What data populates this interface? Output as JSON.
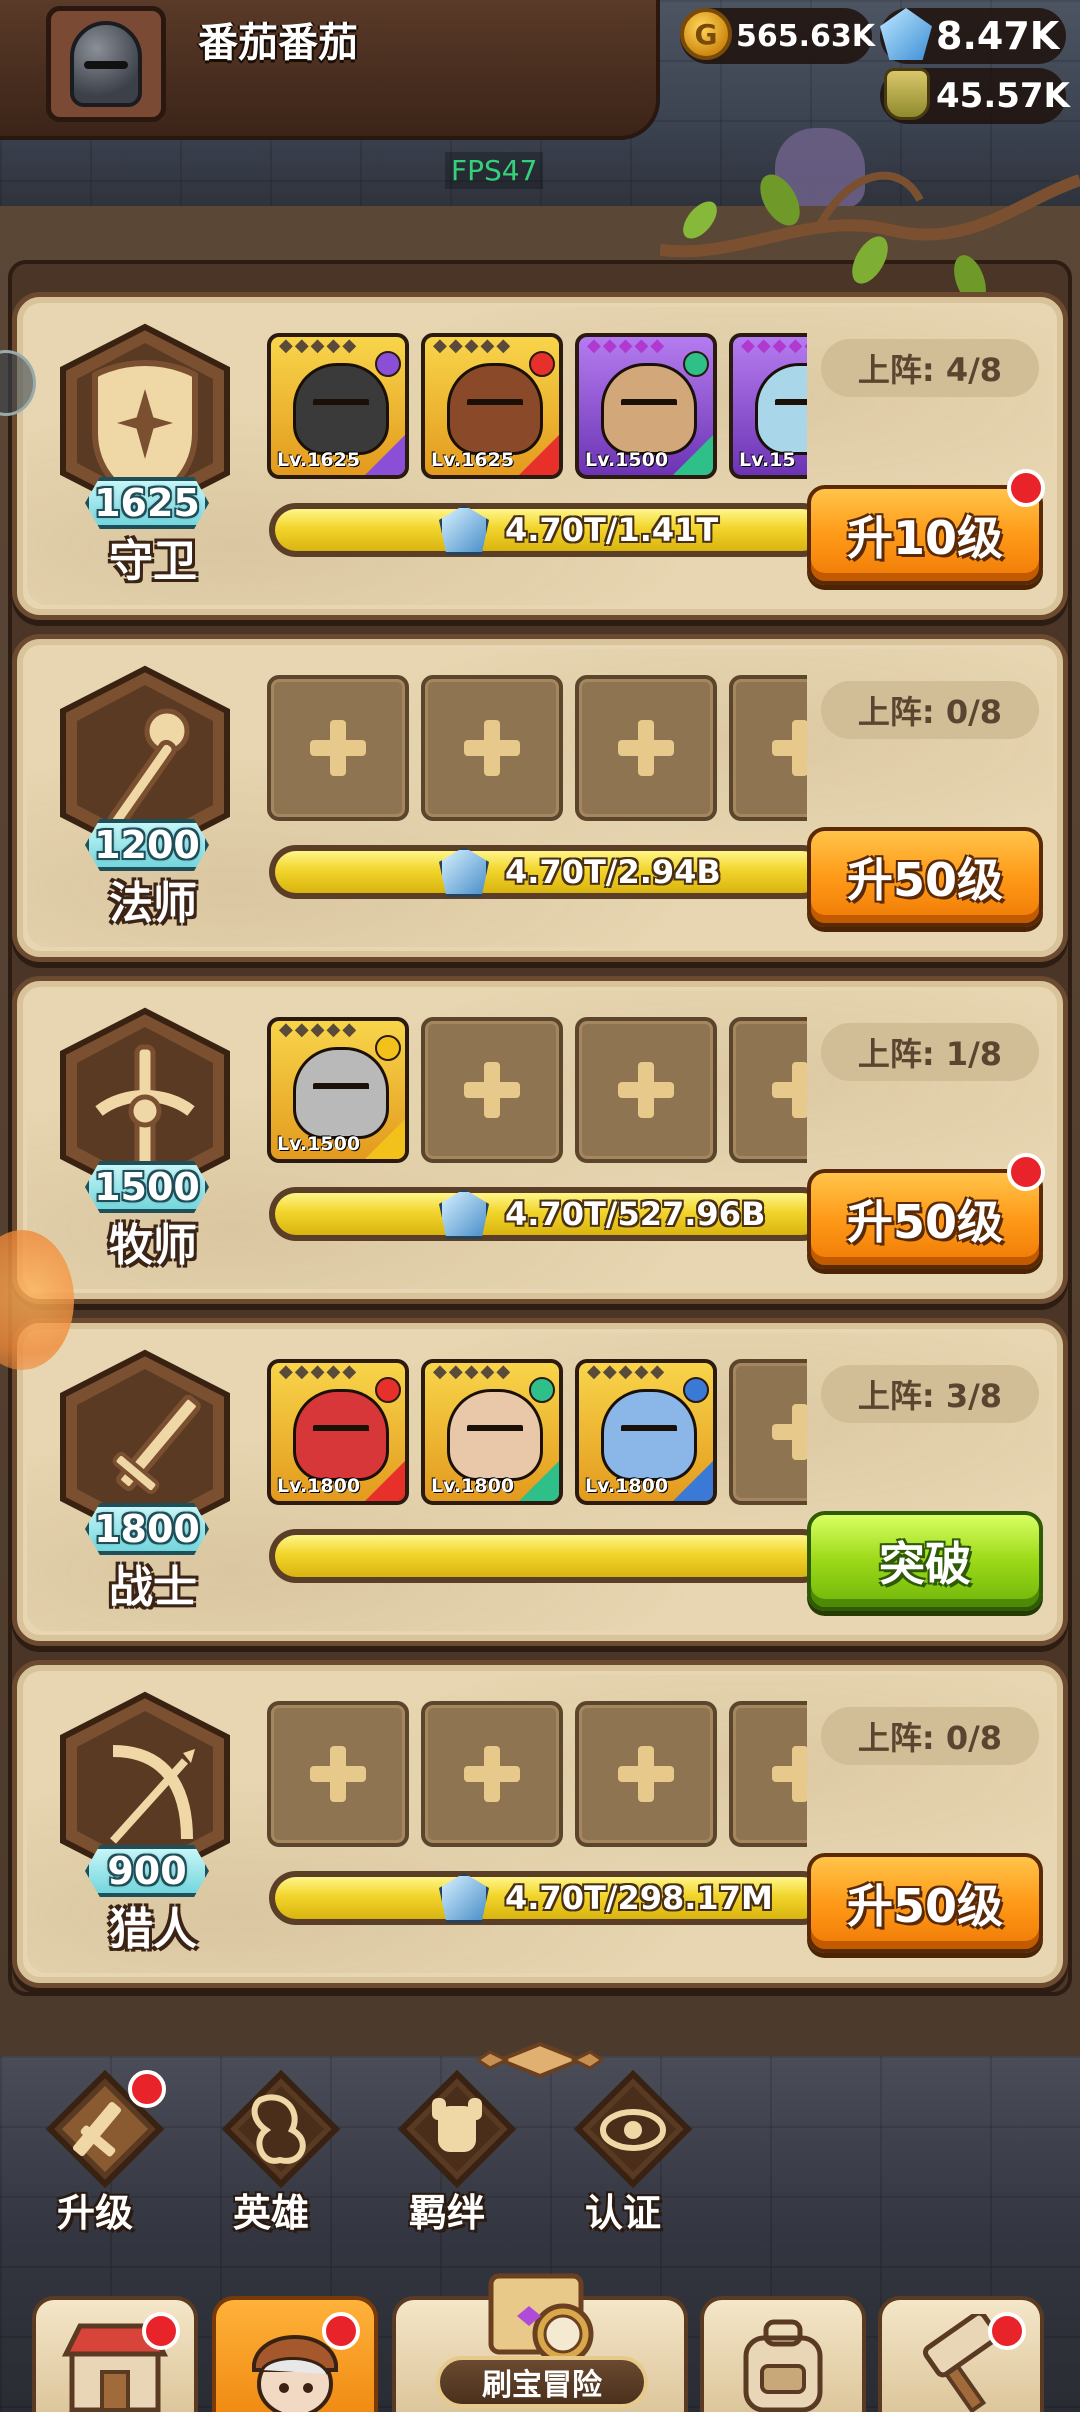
{
  "header": {
    "player_name": "番茄番茄",
    "gold": "565.63K",
    "gems": "8.47K",
    "potion": "45.57K",
    "fps": "FPS47"
  },
  "classes": [
    {
      "name": "守卫",
      "level": "1625",
      "deploy": "上阵: 4/8",
      "progress_text": "4.70T/1.41T",
      "action": "升10级",
      "action_style": "orange",
      "has_dot": true,
      "heroes": [
        {
          "level": "Lv.1625",
          "color": "gold",
          "face": "#3a3a3a",
          "elem": "#8a4fd6"
        },
        {
          "level": "Lv.1625",
          "color": "gold",
          "face": "#8a4a2a",
          "elem": "#e8302a"
        },
        {
          "level": "Lv.1500",
          "color": "purple",
          "face": "#d2a77a",
          "elem": "#2fc08a"
        },
        {
          "level": "Lv.15",
          "color": "purple",
          "face": "#a9d6e8",
          "elem": "#4aa3e8"
        }
      ]
    },
    {
      "name": "法师",
      "level": "1200",
      "deploy": "上阵: 0/8",
      "progress_text": "4.70T/2.94B",
      "action": "升50级",
      "action_style": "orange",
      "has_dot": false,
      "heroes": []
    },
    {
      "name": "牧师",
      "level": "1500",
      "deploy": "上阵: 1/8",
      "progress_text": "4.70T/527.96B",
      "action": "升50级",
      "action_style": "orange",
      "has_dot": true,
      "heroes": [
        {
          "level": "Lv.1500",
          "color": "gold",
          "face": "#b9b9b9",
          "elem": "#f2c21a"
        }
      ]
    },
    {
      "name": "战士",
      "level": "1800",
      "deploy": "上阵: 3/8",
      "progress_text": "",
      "action": "突破",
      "action_style": "green",
      "has_dot": false,
      "heroes": [
        {
          "level": "Lv.1800",
          "color": "gold",
          "face": "#d8373a",
          "elem": "#e8302a"
        },
        {
          "level": "Lv.1800",
          "color": "gold",
          "face": "#e8c8a8",
          "elem": "#2fc08a"
        },
        {
          "level": "Lv.1800",
          "color": "gold",
          "face": "#8ab6e8",
          "elem": "#3a7ad6"
        }
      ]
    },
    {
      "name": "猎人",
      "level": "900",
      "deploy": "上阵: 0/8",
      "progress_text": "4.70T/298.17M",
      "action": "升50级",
      "action_style": "orange",
      "has_dot": false,
      "heroes": []
    }
  ],
  "subnav": [
    {
      "label": "升级",
      "has_dot": true
    },
    {
      "label": "英雄",
      "has_dot": false
    },
    {
      "label": "羁绊",
      "has_dot": false
    },
    {
      "label": "认证",
      "has_dot": false
    }
  ],
  "tabs": {
    "treasure_label": "刷宝冒险"
  },
  "colors": {
    "accent_orange": "#ff9a18",
    "accent_green": "#9bd818",
    "badge_red": "#e8242a",
    "card_bg": "#e7d6b1"
  }
}
